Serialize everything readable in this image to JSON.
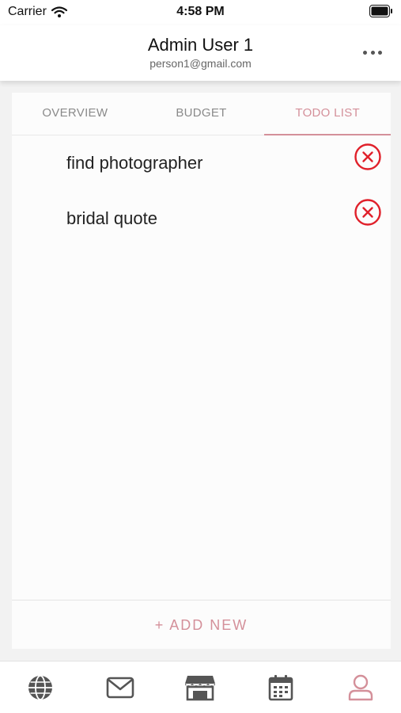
{
  "status_bar": {
    "carrier": "Carrier",
    "time": "4:58 PM"
  },
  "header": {
    "name": "Admin User 1",
    "email": "person1@gmail.com",
    "more_icon": "ellipsis-icon"
  },
  "tabs": [
    {
      "label": "OVERVIEW",
      "active": false
    },
    {
      "label": "BUDGET",
      "active": false
    },
    {
      "label": "TODO LIST",
      "active": true
    }
  ],
  "todos": [
    {
      "text": "find photographer",
      "delete_icon": "close-circle-icon"
    },
    {
      "text": "bridal quote",
      "delete_icon": "close-circle-icon"
    }
  ],
  "add_new_label": "+ ADD NEW",
  "bottom_nav": [
    {
      "icon": "globe-icon",
      "active": false
    },
    {
      "icon": "mail-icon",
      "active": false
    },
    {
      "icon": "store-icon",
      "active": false
    },
    {
      "icon": "calendar-icon",
      "active": false
    },
    {
      "icon": "profile-icon",
      "active": true
    }
  ],
  "colors": {
    "accent": "#d4909a",
    "delete_red": "#e0202a",
    "icon_gray": "#555555"
  }
}
